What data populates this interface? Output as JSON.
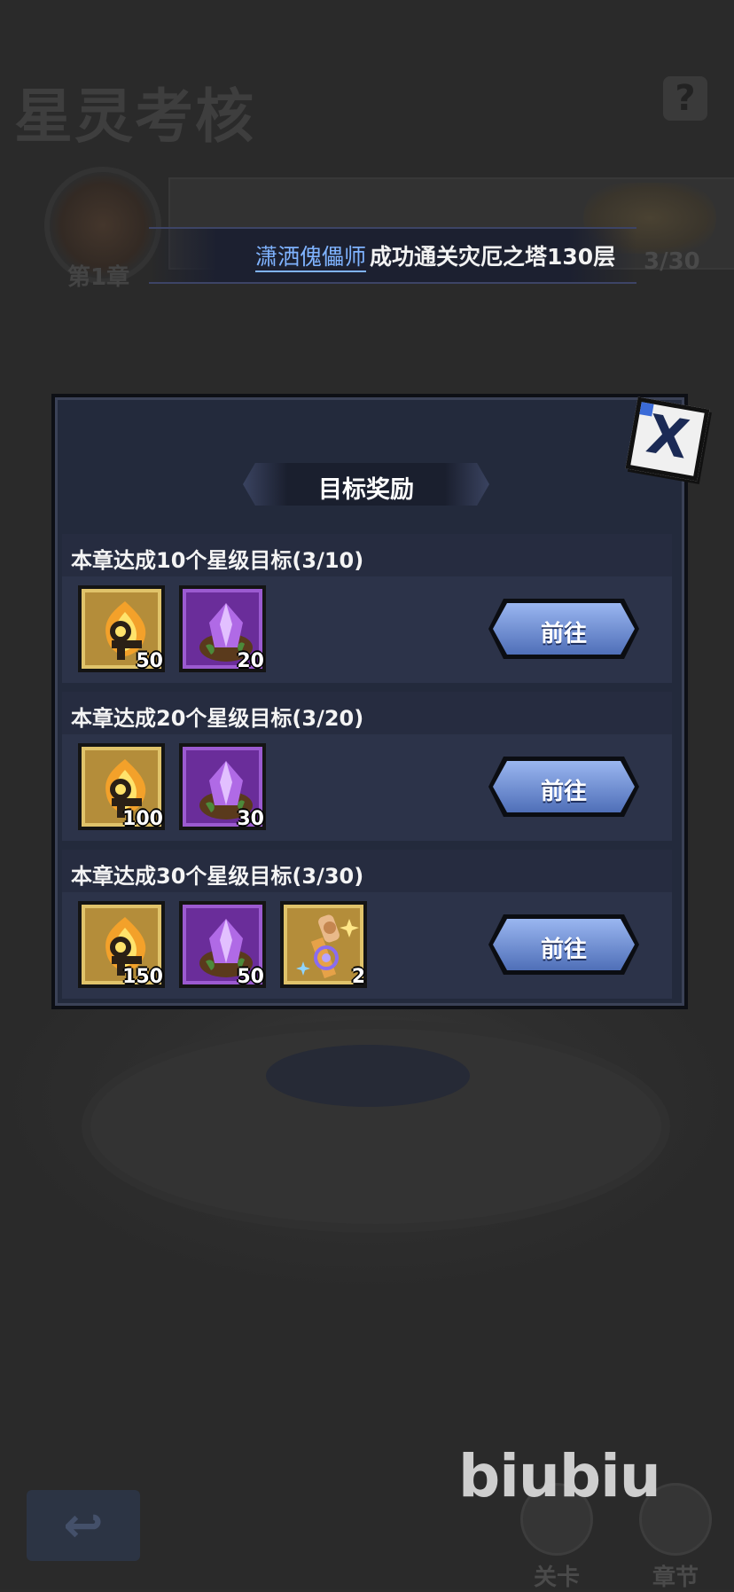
{
  "background": {
    "title": "星灵考核",
    "help_label": "?",
    "chapter": "第1章",
    "progress": "3/30",
    "back_label": "↩",
    "tabs": [
      {
        "label": "关卡"
      },
      {
        "label": "章节"
      }
    ],
    "watermark": "biubiu"
  },
  "banner": {
    "player": "潇洒傀儡师",
    "message": "成功通关灾厄之塔130层"
  },
  "modal": {
    "title": "目标奖励",
    "close_label": "X",
    "rows": [
      {
        "title": "本章达成10个星级目标(3/10)",
        "button": "前往",
        "items": [
          {
            "icon": "ankh-flame-icon",
            "qty": "50",
            "rarity": "gold"
          },
          {
            "icon": "purple-crystal-icon",
            "qty": "20",
            "rarity": "purple"
          }
        ]
      },
      {
        "title": "本章达成20个星级目标(3/20)",
        "button": "前往",
        "items": [
          {
            "icon": "ankh-flame-icon",
            "qty": "100",
            "rarity": "gold"
          },
          {
            "icon": "purple-crystal-icon",
            "qty": "30",
            "rarity": "purple"
          }
        ]
      },
      {
        "title": "本章达成30个星级目标(3/30)",
        "button": "前往",
        "items": [
          {
            "icon": "ankh-flame-icon",
            "qty": "150",
            "rarity": "gold"
          },
          {
            "icon": "purple-crystal-icon",
            "qty": "50",
            "rarity": "purple"
          },
          {
            "icon": "magic-scepter-icon",
            "qty": "2",
            "rarity": "gold"
          }
        ]
      }
    ]
  }
}
